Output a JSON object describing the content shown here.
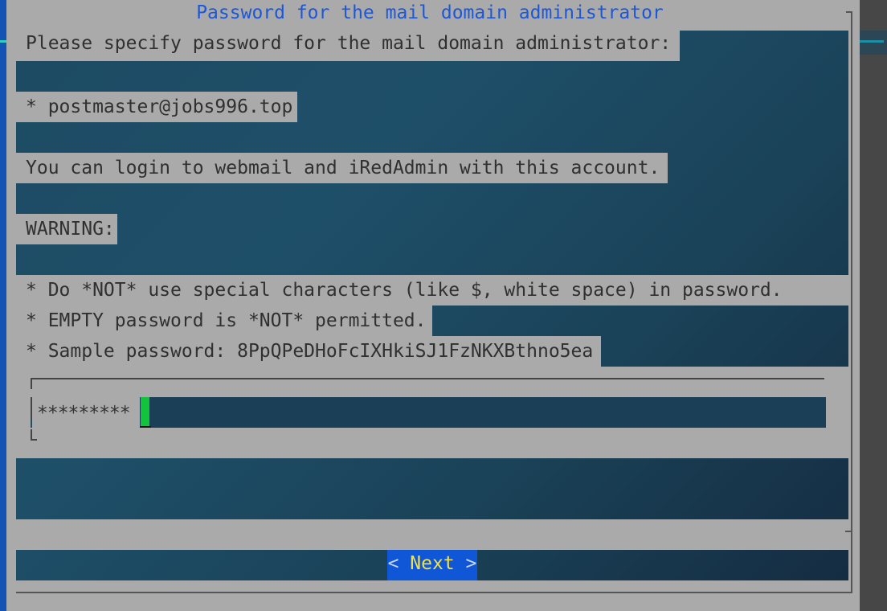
{
  "dialog": {
    "title": "Password for the mail domain administrator",
    "lines": {
      "intro": "Please specify password for the mail domain administrator:",
      "account": "* postmaster@jobs996.top",
      "login_info": "You can login to webmail and iRedAdmin with this account.",
      "warning_heading": "WARNING:",
      "rule_special_chars": "* Do *NOT* use special characters (like $, white space) in password.",
      "rule_empty": "* EMPTY password is *NOT* permitted.",
      "sample": "* Sample password: 8PpQPeDHoFcIXHkiSJ1FzNKXBthno5ea"
    },
    "password_input": {
      "masked_value": "*********"
    },
    "next_button": {
      "left": "<",
      "label": "Next",
      "right": ">"
    }
  },
  "colors": {
    "title": "#1d57d6",
    "dialog_gray": "#aaaaaa",
    "button_bg": "#1057d8",
    "button_text": "#f0e04a",
    "cursor": "#11c43c",
    "background": "#1d4a63"
  },
  "icons": {
    "cursor": "text-cursor-block"
  }
}
